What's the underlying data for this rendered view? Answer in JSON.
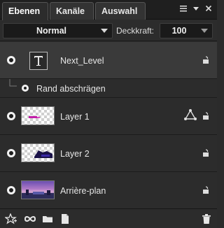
{
  "tabs": [
    {
      "label": "Ebenen",
      "active": true
    },
    {
      "label": "Kanäle",
      "active": false
    },
    {
      "label": "Auswahl",
      "active": false
    }
  ],
  "panel_icons": [
    "menu-icon",
    "dropdown-icon",
    "close-icon"
  ],
  "blend_mode": {
    "value": "Normal"
  },
  "opacity": {
    "label": "Deckkraft:",
    "value": "100"
  },
  "layers": [
    {
      "name": "Next_Level",
      "type": "text",
      "visible": true,
      "locked": false,
      "selected": true
    },
    {
      "name": "Rand abschrägen",
      "type": "effect",
      "visible": true
    },
    {
      "name": "Layer 1",
      "type": "image",
      "visible": true,
      "locked": false,
      "linked_shape": true
    },
    {
      "name": "Layer 2",
      "type": "image",
      "visible": true,
      "locked": false
    },
    {
      "name": "Arrière-plan",
      "type": "image",
      "visible": true,
      "locked": false
    }
  ],
  "toolbar_icons": [
    "add-effect-icon",
    "link-icon",
    "folder-icon",
    "new-layer-icon",
    "trash-icon"
  ],
  "colors": {
    "panel_bg": "#2c2c2c",
    "selected_row": "#3a3a3a",
    "text": "#e6e6e6"
  }
}
